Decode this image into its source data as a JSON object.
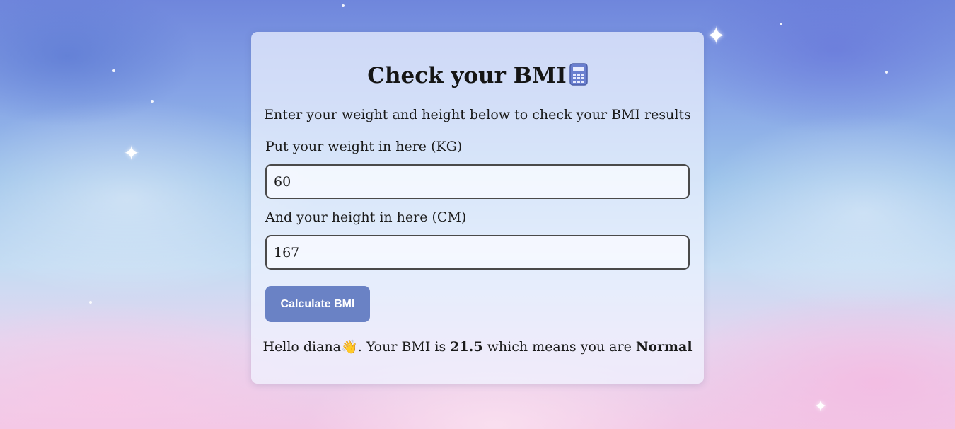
{
  "header": {
    "title": "Check your BMI",
    "title_icon": "calculator-icon",
    "subtitle": "Enter your weight and height below to check your BMI results"
  },
  "form": {
    "weight_label": "Put your weight in here (KG)",
    "weight_value": "60",
    "height_label": "And your height in here (CM)",
    "height_value": "167",
    "button_label": "Calculate BMI"
  },
  "result": {
    "greeting": "Hello diana",
    "wave_emoji": "👋",
    "prefix": ". Your BMI is ",
    "bmi": "21.5",
    "middle": " which means you are ",
    "category": "Normal"
  },
  "colors": {
    "button": "#6a82c5",
    "card": "#f0f4ff",
    "input_border": "#4a4a4a"
  }
}
